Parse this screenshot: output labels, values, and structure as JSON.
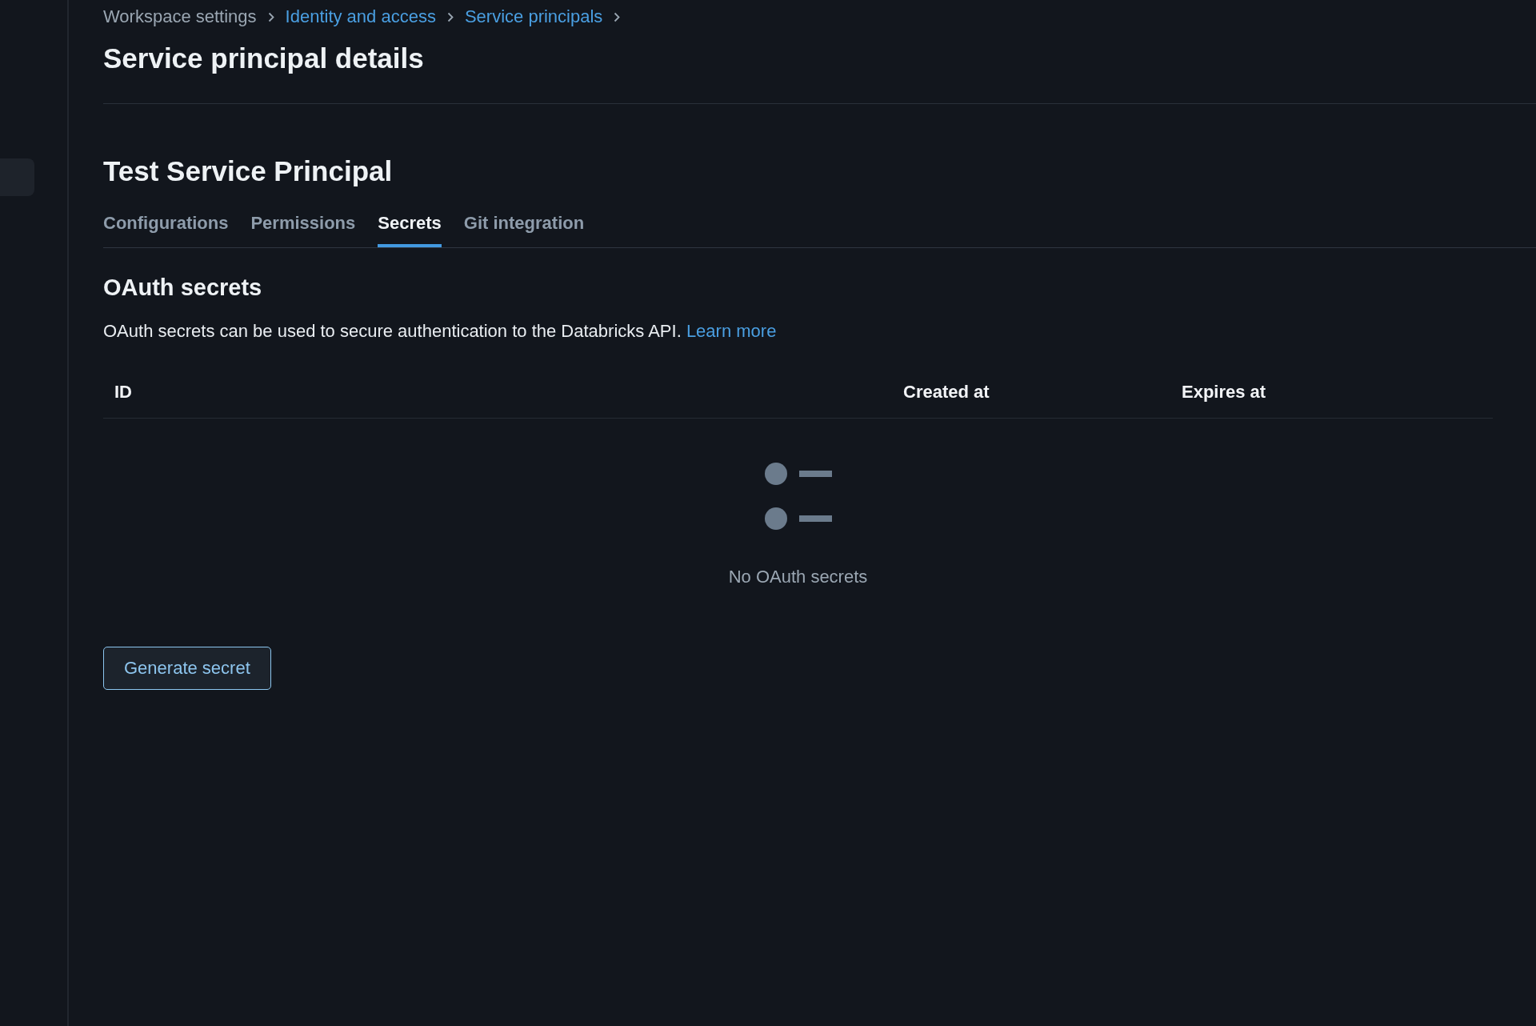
{
  "sidebar": {
    "items": [
      {
        "selected": true
      }
    ]
  },
  "breadcrumb": [
    {
      "label": "Workspace settings",
      "kind": "plain"
    },
    {
      "label": "Identity and access",
      "kind": "link"
    },
    {
      "label": "Service principals",
      "kind": "link"
    }
  ],
  "page_title": "Service principal details",
  "principal": {
    "name": "Test Service Principal"
  },
  "tabs": [
    {
      "label": "Configurations",
      "selected": false
    },
    {
      "label": "Permissions",
      "selected": false
    },
    {
      "label": "Secrets",
      "selected": true
    },
    {
      "label": "Git integration",
      "selected": false
    }
  ],
  "section": {
    "title": "OAuth secrets",
    "description": "OAuth secrets can be used to secure authentication to the Databricks API.",
    "link": "Learn more"
  },
  "table": {
    "columns": [
      "ID",
      "Created at",
      "Expires at"
    ],
    "empty_message": "No OAuth secrets"
  },
  "buttons": [
    {
      "label": "Generate secret"
    }
  ]
}
